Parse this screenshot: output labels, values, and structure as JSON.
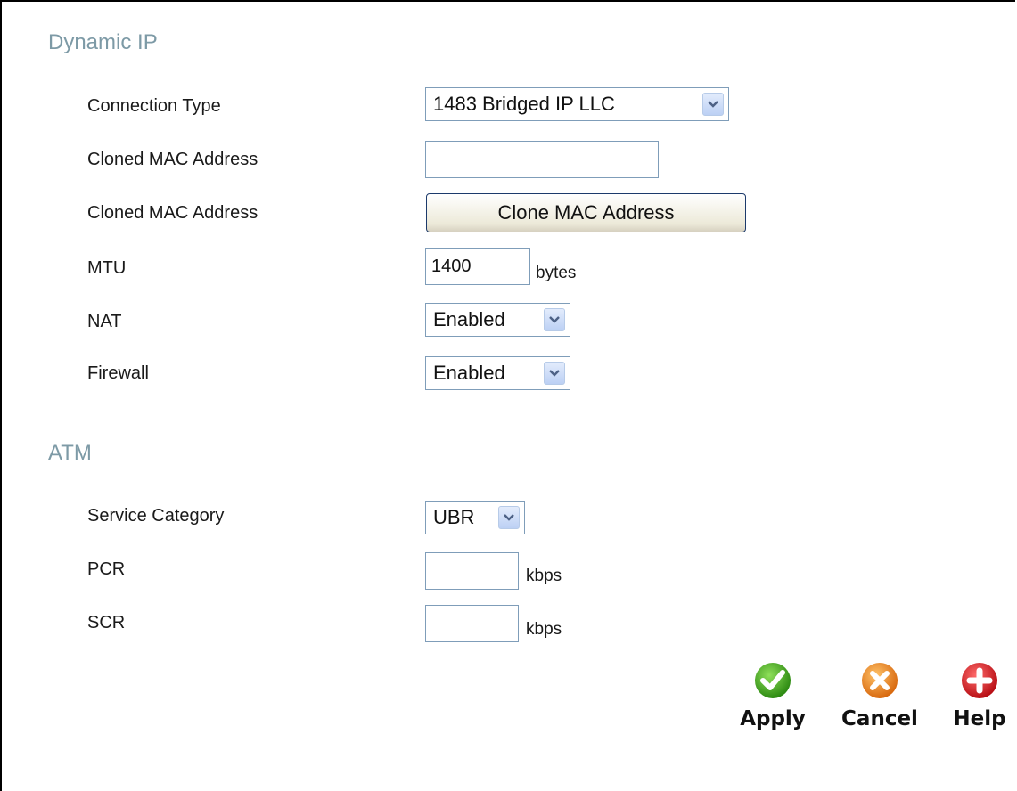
{
  "sections": {
    "dynamic_ip": "Dynamic IP",
    "atm": "ATM"
  },
  "fields": {
    "connection_type": {
      "label": "Connection Type",
      "value": "1483 Bridged IP LLC"
    },
    "cloned_mac": {
      "label": "Cloned MAC Address",
      "value": "",
      "placeholder": ""
    },
    "clone_mac_button": {
      "label": "Cloned MAC Address",
      "button": "Clone MAC Address"
    },
    "mtu": {
      "label": "MTU",
      "value": "1400",
      "unit": "bytes"
    },
    "nat": {
      "label": "NAT",
      "value": "Enabled"
    },
    "firewall": {
      "label": "Firewall",
      "value": "Enabled"
    },
    "service_category": {
      "label": "Service Category",
      "value": "UBR"
    },
    "pcr": {
      "label": "PCR",
      "value": "",
      "unit": "kbps"
    },
    "scr": {
      "label": "SCR",
      "value": "",
      "unit": "kbps"
    }
  },
  "actions": {
    "apply": {
      "label": "Apply",
      "icon": "check-icon",
      "color": "#3a9a1f"
    },
    "cancel": {
      "label": "Cancel",
      "icon": "x-icon",
      "color": "#e0811d"
    },
    "help": {
      "label": "Help",
      "icon": "plus-icon",
      "color": "#c4161c"
    }
  },
  "colors": {
    "section_title": "#7d9aa6",
    "dropdown_arrow": "#4d6185",
    "input_border": "#7f9db9"
  }
}
